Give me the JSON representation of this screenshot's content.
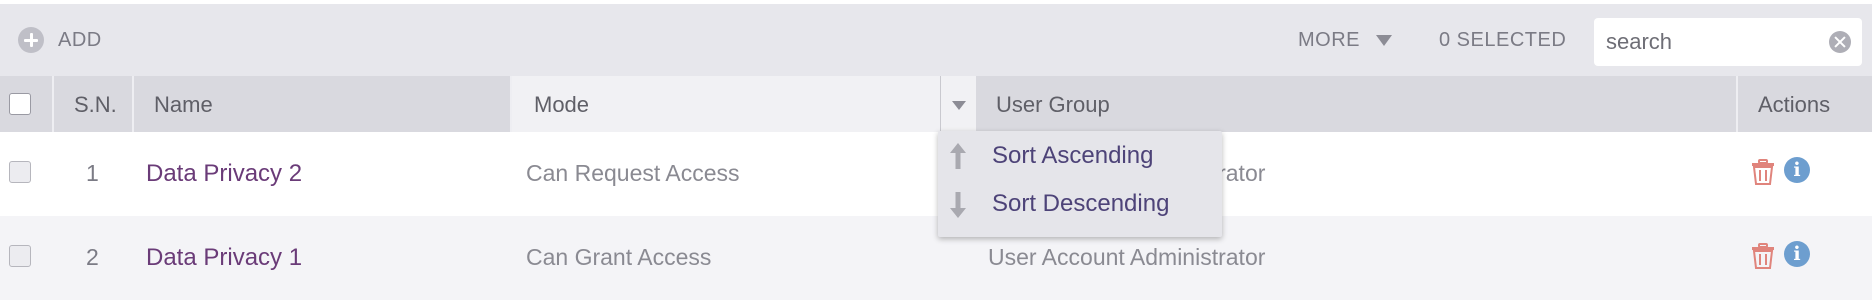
{
  "toolbar": {
    "add_label": "ADD",
    "add_icon": "plus-circle-icon",
    "more_label": "MORE",
    "more_icon": "caret-down-icon",
    "selected_count": "0 SELECTED",
    "search": {
      "value": "",
      "placeholder": "search",
      "clear_icon": "clear-circle-icon"
    }
  },
  "table": {
    "headers": {
      "sn": "S.N.",
      "name": "Name",
      "mode": "Mode",
      "user_group": "User Group",
      "actions": "Actions"
    },
    "rows": [
      {
        "sn": "1",
        "name": "Data Privacy 2",
        "mode": "Can Request Access",
        "user_group": "User Account Administrator"
      },
      {
        "sn": "2",
        "name": "Data Privacy 1",
        "mode": "Can Grant Access",
        "user_group": "User Account Administrator"
      }
    ],
    "action_icons": [
      "trash-icon",
      "info-icon"
    ],
    "info_glyph": "i"
  },
  "sort_menu": {
    "items": [
      {
        "label": "Sort Ascending",
        "icon": "arrow-up-icon"
      },
      {
        "label": "Sort Descending",
        "icon": "arrow-down-icon"
      }
    ]
  },
  "colors": {
    "toolbar_bg": "#e7e7ec",
    "header_bg": "#d9d9df",
    "link": "#6a3b78",
    "trash": "#e0847c",
    "info": "#6d9ecf",
    "menu_text": "#4d4378"
  }
}
